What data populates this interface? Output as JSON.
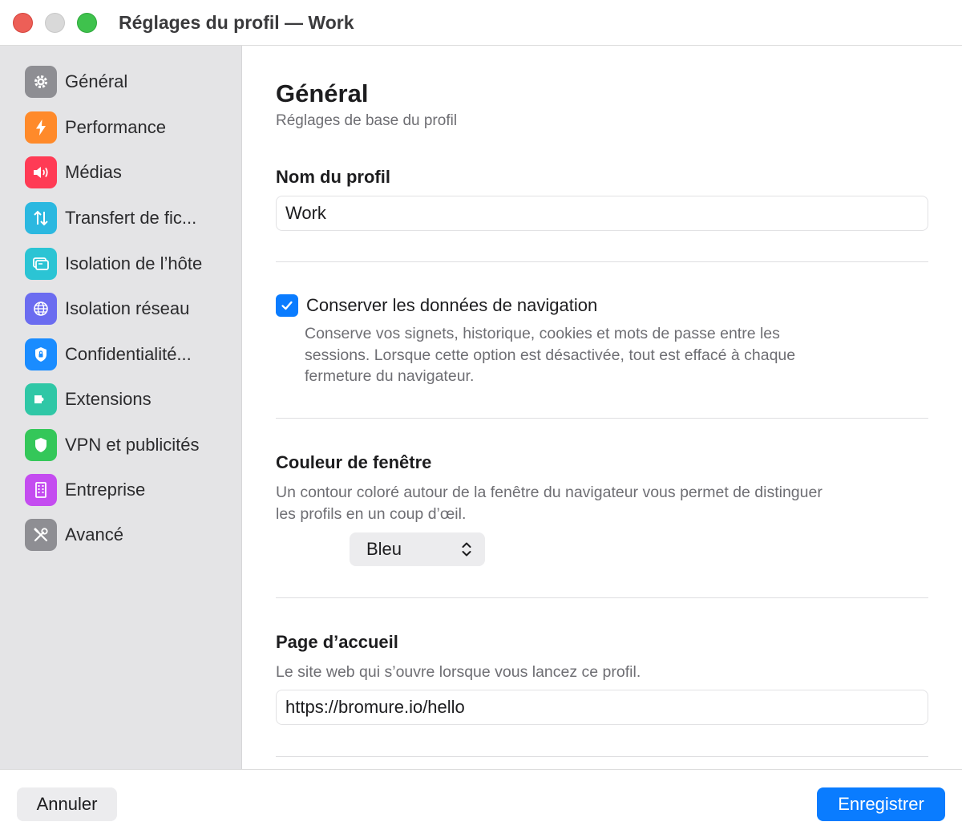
{
  "window": {
    "title": "Réglages du profil — Work"
  },
  "sidebar": {
    "items": [
      {
        "label": "Général",
        "icon": "gear-icon",
        "color": "#8e8e93",
        "selected": true
      },
      {
        "label": "Performance",
        "icon": "bolt-icon",
        "color": "#ff8a2a"
      },
      {
        "label": "Médias",
        "icon": "speaker-icon",
        "color": "#ff3b55"
      },
      {
        "label": "Transfert de fic...",
        "icon": "transfer-arrows-icon",
        "color": "#2bb8e0"
      },
      {
        "label": "Isolation de l’hôte",
        "icon": "window-icon",
        "color": "#2bc4d4"
      },
      {
        "label": "Isolation réseau",
        "icon": "globe-icon",
        "color": "#6b6cf0"
      },
      {
        "label": "Confidentialité...",
        "icon": "privacy-lock-icon",
        "color": "#1a8cff"
      },
      {
        "label": "Extensions",
        "icon": "puzzle-icon",
        "color": "#2fc7a6"
      },
      {
        "label": "VPN et publicités",
        "icon": "shield-icon",
        "color": "#34c759"
      },
      {
        "label": "Entreprise",
        "icon": "building-icon",
        "color": "#c44cf0"
      },
      {
        "label": "Avancé",
        "icon": "tools-icon",
        "color": "#8e8e93"
      }
    ]
  },
  "main": {
    "title": "Général",
    "subtitle": "Réglages de base du profil",
    "profile_name": {
      "label": "Nom du profil",
      "value": "Work"
    },
    "keep_data": {
      "checked": true,
      "label": "Conserver les données de navigation",
      "description_line1": "Conserve vos signets, historique, cookies et mots de passe entre les",
      "description_line2": "sessions. Lorsque cette option est désactivée, tout est effacé à chaque",
      "description_line3": "fermeture du navigateur."
    },
    "window_color": {
      "label": "Couleur de fenêtre",
      "description_line1": "Un contour coloré autour de la fenêtre du navigateur vous permet de distinguer",
      "description_line2": "les profils en un coup d’œil.",
      "selected": "Bleu"
    },
    "homepage": {
      "label": "Page d’accueil",
      "description": "Le site web qui s’ouvre lorsque vous lancez ce profil.",
      "value": "https://bromure.io/hello"
    }
  },
  "footer": {
    "cancel_label": "Annuler",
    "save_label": "Enregistrer"
  },
  "colors": {
    "accent": "#0a7cff"
  }
}
